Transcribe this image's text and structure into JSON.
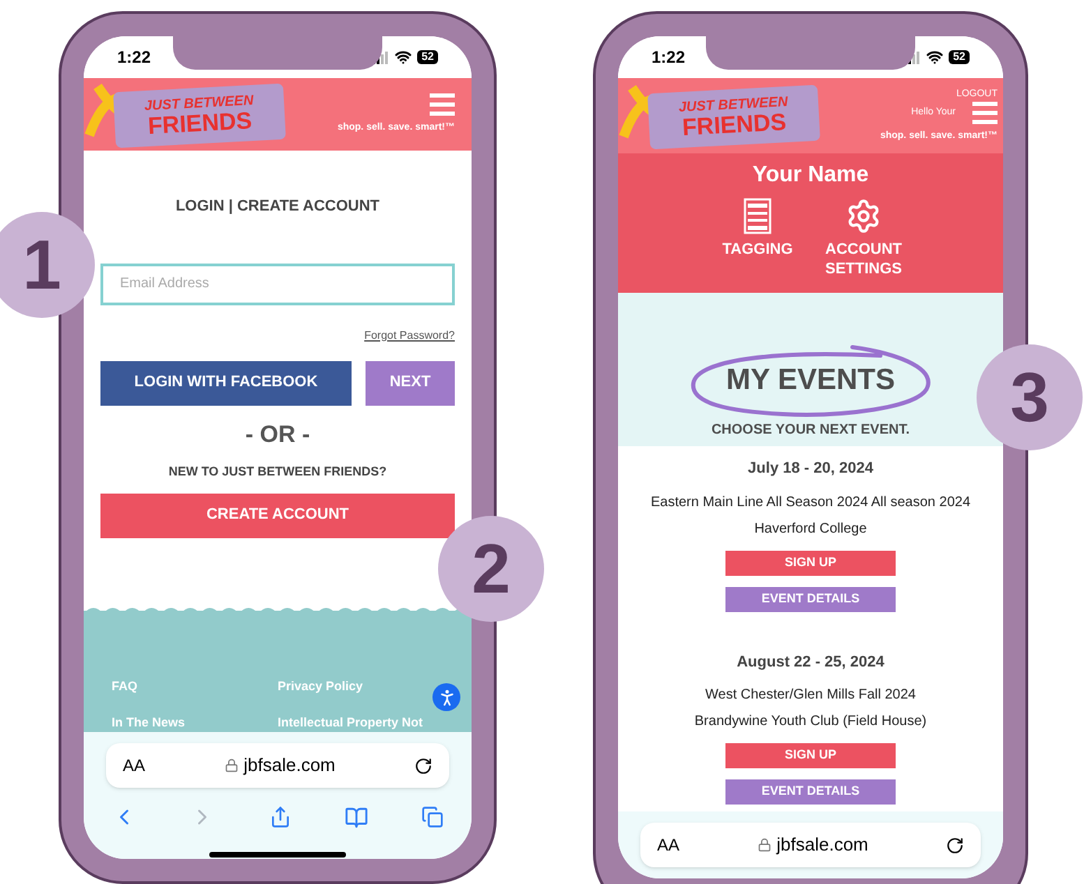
{
  "step_badges": [
    "1",
    "2",
    "3"
  ],
  "login_screen": {
    "status": {
      "time": "1:22",
      "battery": "52"
    },
    "header": {
      "logo_top": "JUST BETWEEN",
      "logo_bottom": "FRIENDS",
      "tagline": "shop. sell. save. smart!™"
    },
    "heading": "LOGIN | CREATE ACCOUNT",
    "email": {
      "placeholder": "Email Address"
    },
    "forgot_link": "Forgot Password?",
    "facebook_button": "LOGIN WITH FACEBOOK",
    "next_button": "NEXT",
    "divider": "- OR -",
    "new_prompt": "NEW TO JUST BETWEEN FRIENDS?",
    "create_button": "CREATE ACCOUNT",
    "footer_links": [
      "FAQ",
      "Privacy Policy",
      "In The News",
      "Intellectual Property Not"
    ],
    "browser": {
      "text_size": "AA",
      "url": "jbfsale.com"
    }
  },
  "events_screen": {
    "status": {
      "time": "1:22",
      "battery": "52"
    },
    "header": {
      "logo_top": "JUST BETWEEN",
      "logo_bottom": "FRIENDS",
      "tagline": "shop. sell. save. smart!™",
      "logout": "LOGOUT",
      "greeting": "Hello Your"
    },
    "user_name": "Your Name",
    "shortcuts": [
      {
        "kind": "tagging",
        "label": "TAGGING"
      },
      {
        "kind": "settings",
        "label": "ACCOUNT SETTINGS"
      }
    ],
    "title": "MY EVENTS",
    "subtitle": "CHOOSE YOUR NEXT EVENT.",
    "events": [
      {
        "dates": "July 18 - 20, 2024",
        "name": "Eastern Main Line All Season 2024 All season 2024",
        "venue": "Haverford College",
        "signup": "SIGN UP",
        "details": "EVENT DETAILS"
      },
      {
        "dates": "August 22 - 25, 2024",
        "name": "West Chester/Glen Mills Fall 2024",
        "venue": "Brandywine Youth Club (Field House)",
        "signup": "SIGN UP",
        "details": "EVENT DETAILS"
      }
    ],
    "browser": {
      "text_size": "AA",
      "url": "jbfsale.com"
    }
  }
}
